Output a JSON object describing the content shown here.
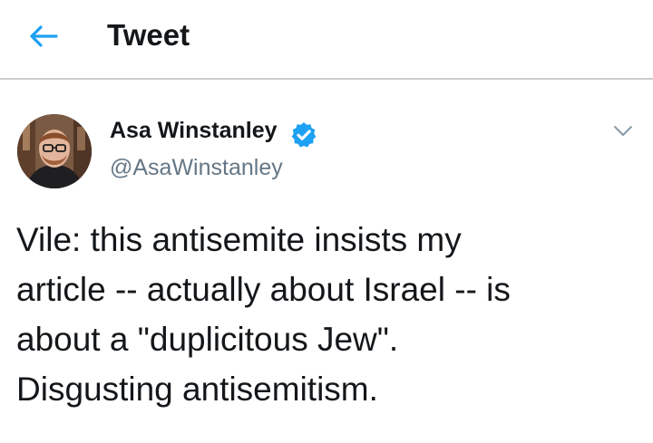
{
  "header": {
    "back_icon": "arrow-left-icon",
    "title": "Tweet"
  },
  "tweet": {
    "author": {
      "name": "Asa Winstanley",
      "handle": "@AsaWinstanley",
      "verified_icon": "verified-badge-icon",
      "avatar_icon": "user-avatar"
    },
    "menu_icon": "chevron-down-icon",
    "text_lines": [
      "Vile: this antisemite insists my",
      "article -- actually about Israel -- is",
      "about a \"duplicitous Jew\".",
      "Disgusting antisemitism."
    ]
  },
  "colors": {
    "accent": "#1da1f2",
    "text": "#14171a",
    "secondary_text": "#657786",
    "divider": "#c9cdd1"
  }
}
